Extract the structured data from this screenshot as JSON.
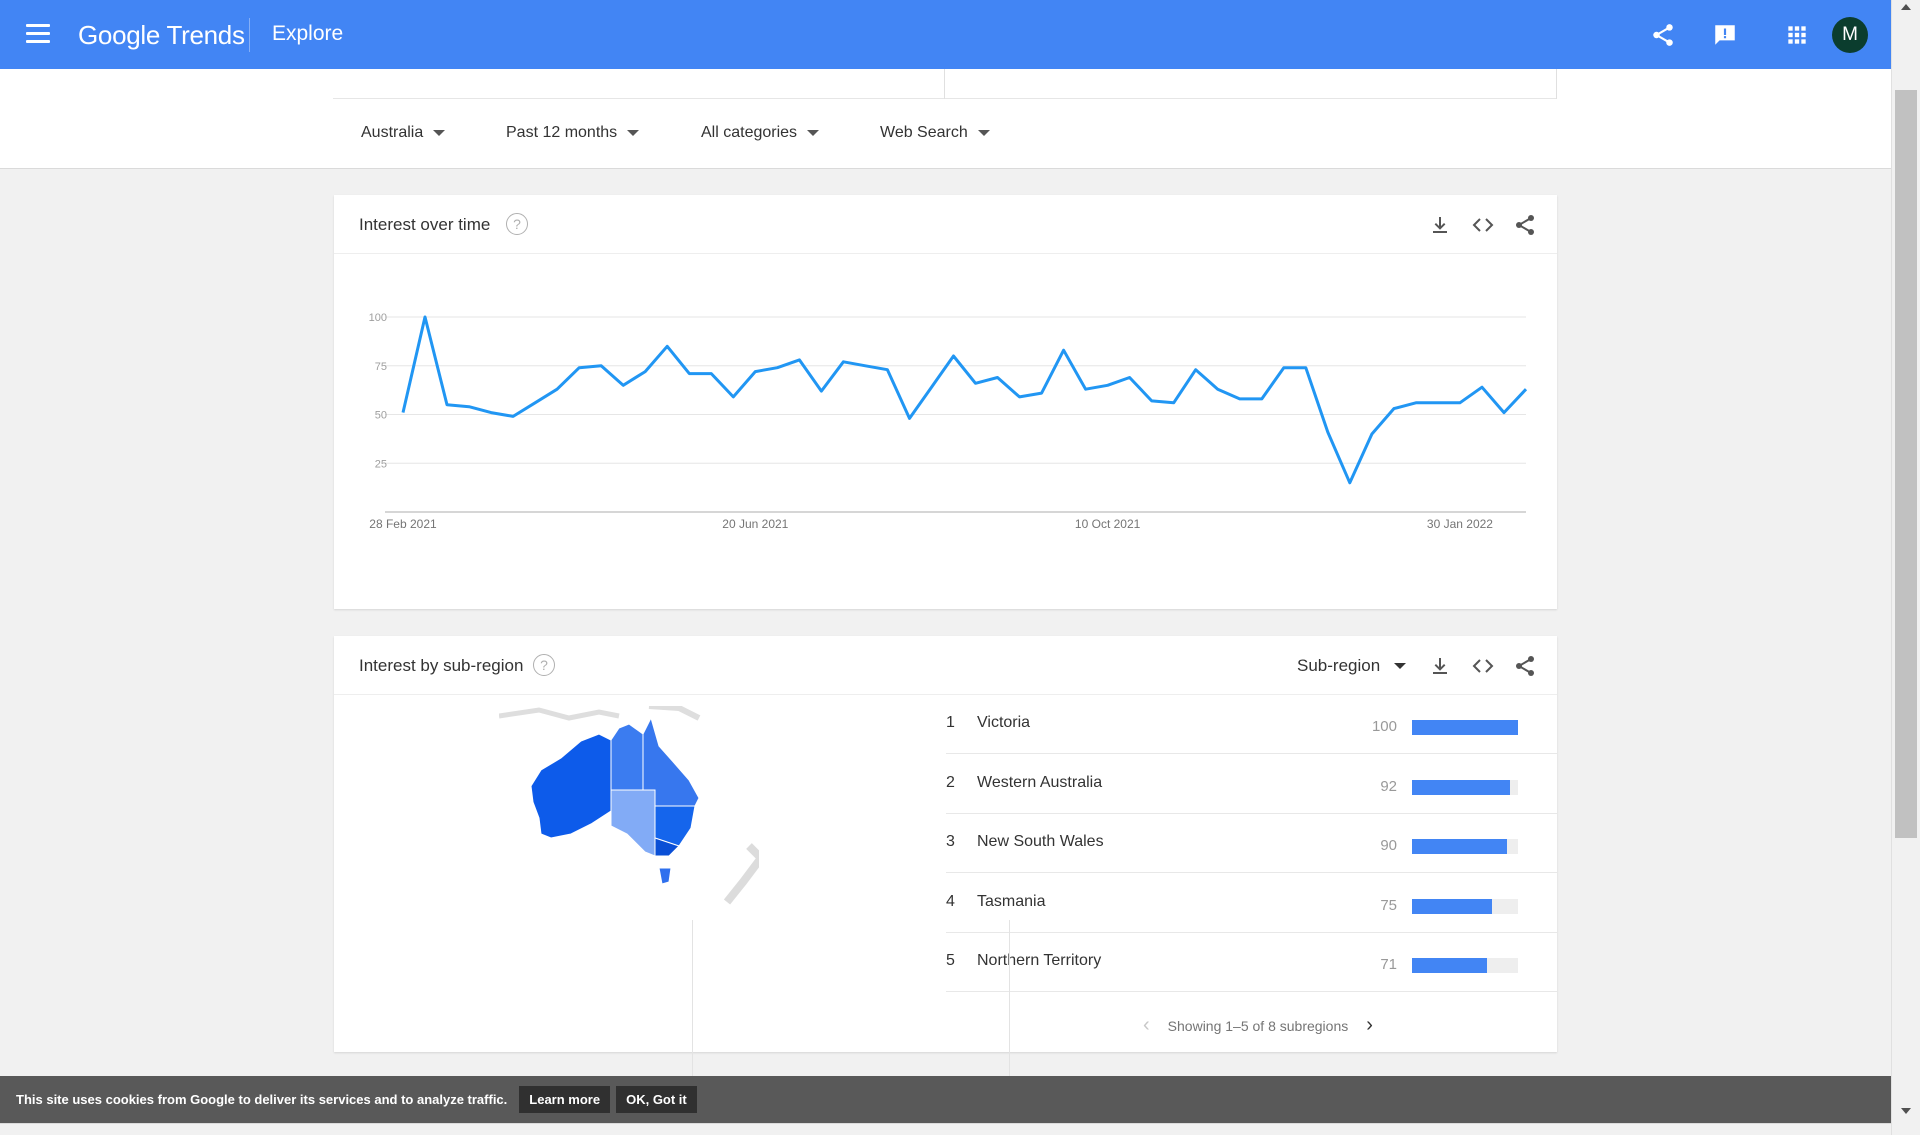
{
  "header": {
    "logo": "Google Trends",
    "section": "Explore",
    "avatar_letter": "M",
    "color": "#4285f4"
  },
  "filters": [
    {
      "label": "Australia"
    },
    {
      "label": "Past 12 months"
    },
    {
      "label": "All categories"
    },
    {
      "label": "Web Search"
    }
  ],
  "interest_over_time": {
    "title": "Interest over time",
    "help": "?",
    "y_ticks": [
      "100",
      "75",
      "50",
      "25"
    ],
    "x_ticks": [
      "28 Feb 2021",
      "20 Jun 2021",
      "10 Oct 2021",
      "30 Jan 2022"
    ]
  },
  "chart_data": {
    "type": "line",
    "title": "Interest over time",
    "xlabel": "",
    "ylabel": "",
    "ylim": [
      0,
      100
    ],
    "grid": true,
    "color": "#2196f3",
    "x_ticks": [
      "28 Feb 2021",
      "20 Jun 2021",
      "10 Oct 2021",
      "30 Jan 2022"
    ],
    "series": [
      {
        "values": [
          51,
          100,
          55,
          54,
          51,
          49,
          56,
          63,
          74,
          75,
          65,
          72,
          85,
          71,
          71,
          59,
          72,
          74,
          78,
          62,
          77,
          75,
          73,
          48,
          64,
          80,
          66,
          69,
          59,
          61,
          83,
          63,
          65,
          69,
          57,
          56,
          73,
          63,
          58,
          58,
          74,
          74,
          41,
          15,
          40,
          53,
          56,
          56,
          56,
          64,
          51,
          63
        ]
      }
    ]
  },
  "interest_by_region": {
    "title": "Interest by sub-region",
    "help": "?",
    "resolution_label": "Sub-region",
    "rows": [
      {
        "rank": "1",
        "name": "Victoria",
        "value": "100"
      },
      {
        "rank": "2",
        "name": "Western Australia",
        "value": "92"
      },
      {
        "rank": "3",
        "name": "New South Wales",
        "value": "90"
      },
      {
        "rank": "4",
        "name": "Tasmania",
        "value": "75"
      },
      {
        "rank": "5",
        "name": "Northern Territory",
        "value": "71"
      }
    ],
    "bar_levels": [
      100,
      92,
      90,
      75,
      71
    ],
    "pager": "Showing 1–5 of 8 subregions",
    "bar_color": "#4285f4"
  },
  "cookie": {
    "text": "This site uses cookies from Google to deliver its services and to analyze traffic.",
    "learn_more": "Learn more",
    "ok": "OK, Got it"
  }
}
